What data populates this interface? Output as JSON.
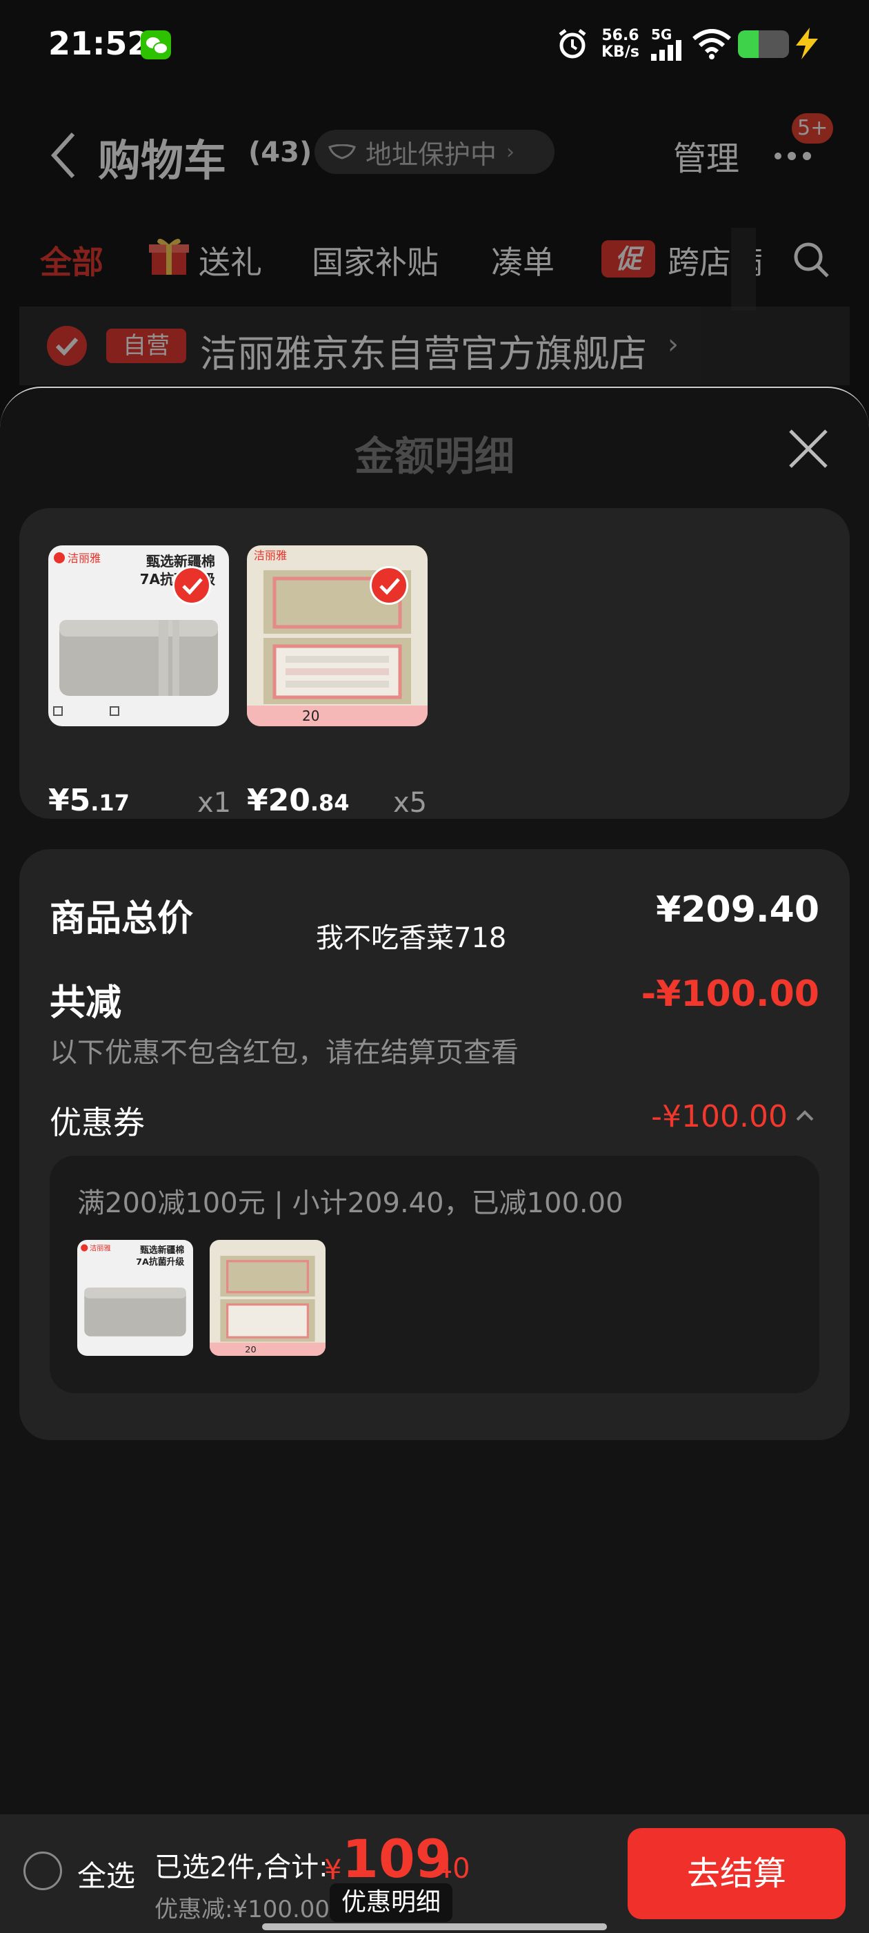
{
  "status_bar": {
    "time": "21:52",
    "net_speed": "56.6",
    "net_unit": "KB/s",
    "network": "5G"
  },
  "header": {
    "title": "购物车",
    "count": "(43)",
    "address_pill": "地址保护中",
    "manage": "管理",
    "more_badge": "5+"
  },
  "tabs": [
    {
      "label": "全部",
      "active": true
    },
    {
      "label": "送礼",
      "icon": "gift-icon"
    },
    {
      "label": "国家补贴"
    },
    {
      "label": "凑单"
    },
    {
      "label": "跨店满",
      "icon_text": "促"
    }
  ],
  "store": {
    "tag": "自营",
    "name": "洁丽雅京东自营官方旗舰店"
  },
  "sheet": {
    "title": "金额明细",
    "products": [
      {
        "name": "towel",
        "brand": "洁丽雅",
        "img_line1": "甄选新疆棉",
        "img_line2": "7A抗菌升级",
        "price_int": "¥5",
        "price_dec": ".17",
        "qty": "x1"
      },
      {
        "name": "storage-box",
        "brand": "洁丽雅",
        "img_badge": "20",
        "price_int": "¥20",
        "price_dec": ".84",
        "qty": "x5"
      }
    ],
    "total_label": "商品总价",
    "total_value": "¥209.40",
    "watermark": "我不吃香菜718",
    "reduce_label": "共减",
    "reduce_value": "-¥100.00",
    "note": "以下优惠不包含红包，请在结算页查看",
    "coupon_label": "优惠券",
    "coupon_value": "-¥100.00",
    "coupon_desc": "满200减100元 | 小计209.40，已减100.00"
  },
  "bottom_bar": {
    "select_all": "全选",
    "selected": "已选2件,合计:",
    "yen": "¥",
    "sum_int": "109",
    "sum_dec": ".40",
    "discount": "优惠减:¥100.00",
    "detail_link": "优惠明细",
    "checkout": "去结算"
  },
  "colors": {
    "accent": "#f0302a",
    "background": "#0d0d0d",
    "card": "#232323"
  }
}
